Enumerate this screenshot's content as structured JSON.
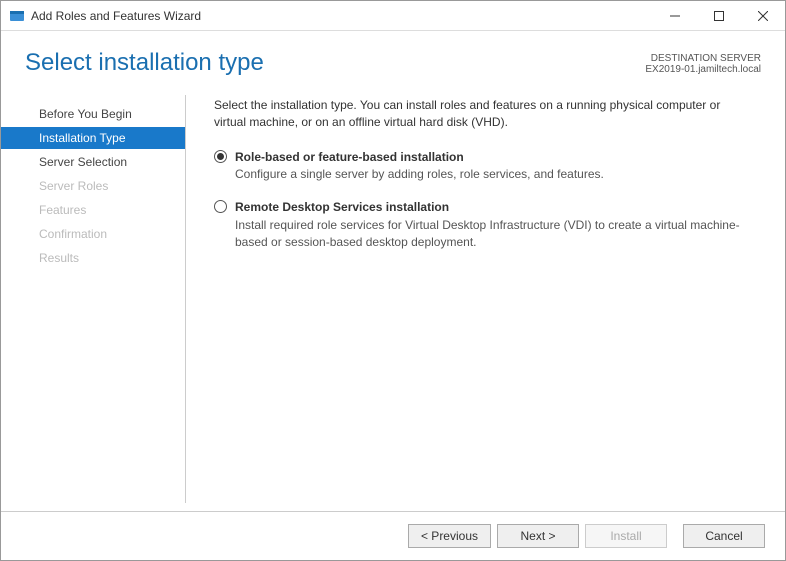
{
  "window": {
    "title": "Add Roles and Features Wizard"
  },
  "header": {
    "title": "Select installation type",
    "dest_label": "DESTINATION SERVER",
    "dest_server": "EX2019-01.jamiltech.local"
  },
  "sidebar": {
    "items": [
      {
        "label": "Before You Begin",
        "state": "enabled"
      },
      {
        "label": "Installation Type",
        "state": "active"
      },
      {
        "label": "Server Selection",
        "state": "enabled"
      },
      {
        "label": "Server Roles",
        "state": "disabled"
      },
      {
        "label": "Features",
        "state": "disabled"
      },
      {
        "label": "Confirmation",
        "state": "disabled"
      },
      {
        "label": "Results",
        "state": "disabled"
      }
    ]
  },
  "content": {
    "intro": "Select the installation type. You can install roles and features on a running physical computer or virtual machine, or on an offline virtual hard disk (VHD).",
    "options": [
      {
        "title": "Role-based or feature-based installation",
        "desc": "Configure a single server by adding roles, role services, and features.",
        "selected": true
      },
      {
        "title": "Remote Desktop Services installation",
        "desc": "Install required role services for Virtual Desktop Infrastructure (VDI) to create a virtual machine-based or session-based desktop deployment.",
        "selected": false
      }
    ]
  },
  "footer": {
    "previous": "< Previous",
    "next": "Next >",
    "install": "Install",
    "cancel": "Cancel"
  }
}
